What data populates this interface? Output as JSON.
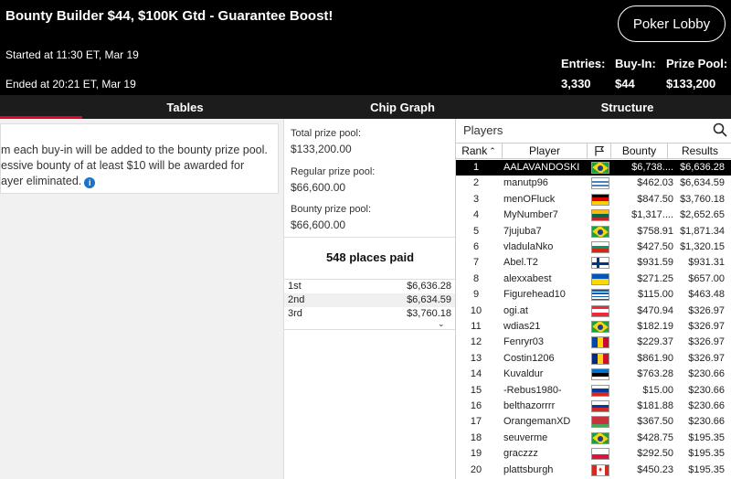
{
  "header": {
    "title": "Bounty Builder $44, $100K Gtd - Guarantee Boost!",
    "started": "Started at 11:30 ET, Mar 19",
    "ended": "Ended at 20:21 ET, Mar 19",
    "lobby_button": "Poker Lobby",
    "stats": [
      {
        "label": "Entries:",
        "value": "3,330"
      },
      {
        "label": "Buy-In:",
        "value": "$44"
      },
      {
        "label": "Prize Pool:",
        "value": "$133,200"
      }
    ]
  },
  "tabs": [
    "Tables",
    "Chip Graph",
    "Structure"
  ],
  "info": {
    "lines": [
      "m each buy-in will be added to the bounty prize pool.",
      "essive bounty of at least $10 will be awarded for",
      "ayer eliminated."
    ]
  },
  "prize": {
    "total_label": "Total prize pool:",
    "total_value": "$133,200.00",
    "regular_label": "Regular prize pool:",
    "regular_value": "$66,600.00",
    "bounty_label": "Bounty prize pool:",
    "bounty_value": "$66,600.00",
    "places_paid": "548 places paid",
    "payouts": [
      {
        "place": "1st",
        "amount": "$6,636.28"
      },
      {
        "place": "2nd",
        "amount": "$6,634.59"
      },
      {
        "place": "3rd",
        "amount": "$3,760.18"
      }
    ]
  },
  "players": {
    "heading": "Players",
    "columns": {
      "rank": "Rank",
      "player": "Player",
      "bounty": "Bounty",
      "results": "Results"
    },
    "rows": [
      {
        "rank": "1",
        "name": "AALAVANDOSKI",
        "flag": "brazil",
        "bounty": "$6,738....",
        "result": "$6,636.28"
      },
      {
        "rank": "2",
        "name": "manutp96",
        "flag": "uruguay",
        "bounty": "$462.03",
        "result": "$6,634.59"
      },
      {
        "rank": "3",
        "name": "menOFluck",
        "flag": "germany",
        "bounty": "$847.50",
        "result": "$3,760.18"
      },
      {
        "rank": "4",
        "name": "MyNumber7",
        "flag": "lithuania",
        "bounty": "$1,317....",
        "result": "$2,652.65"
      },
      {
        "rank": "5",
        "name": "7jujuba7",
        "flag": "brazil",
        "bounty": "$758.91",
        "result": "$1,871.34"
      },
      {
        "rank": "6",
        "name": "vladulaNko",
        "flag": "bulgaria",
        "bounty": "$427.50",
        "result": "$1,320.15"
      },
      {
        "rank": "7",
        "name": "Abel.T2",
        "flag": "finland",
        "bounty": "$931.59",
        "result": "$931.31"
      },
      {
        "rank": "8",
        "name": "alexxabest",
        "flag": "ukraine",
        "bounty": "$271.25",
        "result": "$657.00"
      },
      {
        "rank": "9",
        "name": "Figurehead10",
        "flag": "greece",
        "bounty": "$115.00",
        "result": "$463.48"
      },
      {
        "rank": "10",
        "name": "ogi.at",
        "flag": "austria",
        "bounty": "$470.94",
        "result": "$326.97"
      },
      {
        "rank": "11",
        "name": "wdias21",
        "flag": "brazil",
        "bounty": "$182.19",
        "result": "$326.97"
      },
      {
        "rank": "12",
        "name": "Fenryr03",
        "flag": "moldova",
        "bounty": "$229.37",
        "result": "$326.97"
      },
      {
        "rank": "13",
        "name": "Costin1206",
        "flag": "romania",
        "bounty": "$861.90",
        "result": "$326.97"
      },
      {
        "rank": "14",
        "name": "Kuvaldur",
        "flag": "estonia",
        "bounty": "$763.28",
        "result": "$230.66"
      },
      {
        "rank": "15",
        "name": "-Rebus1980-",
        "flag": "russia",
        "bounty": "$15.00",
        "result": "$230.66"
      },
      {
        "rank": "16",
        "name": "belthazorrrr",
        "flag": "russia",
        "bounty": "$181.88",
        "result": "$230.66"
      },
      {
        "rank": "17",
        "name": "OrangemanXD",
        "flag": "belarus",
        "bounty": "$367.50",
        "result": "$230.66"
      },
      {
        "rank": "18",
        "name": "seuverme",
        "flag": "brazil",
        "bounty": "$428.75",
        "result": "$195.35"
      },
      {
        "rank": "19",
        "name": "graczzz",
        "flag": "poland",
        "bounty": "$292.50",
        "result": "$195.35"
      },
      {
        "rank": "20",
        "name": "plattsburgh",
        "flag": "canada",
        "bounty": "$450.23",
        "result": "$195.35"
      }
    ]
  },
  "colors": {
    "accent": "#e3002b",
    "header_bg": "#000000",
    "tab_bg": "#1c1c1c"
  }
}
